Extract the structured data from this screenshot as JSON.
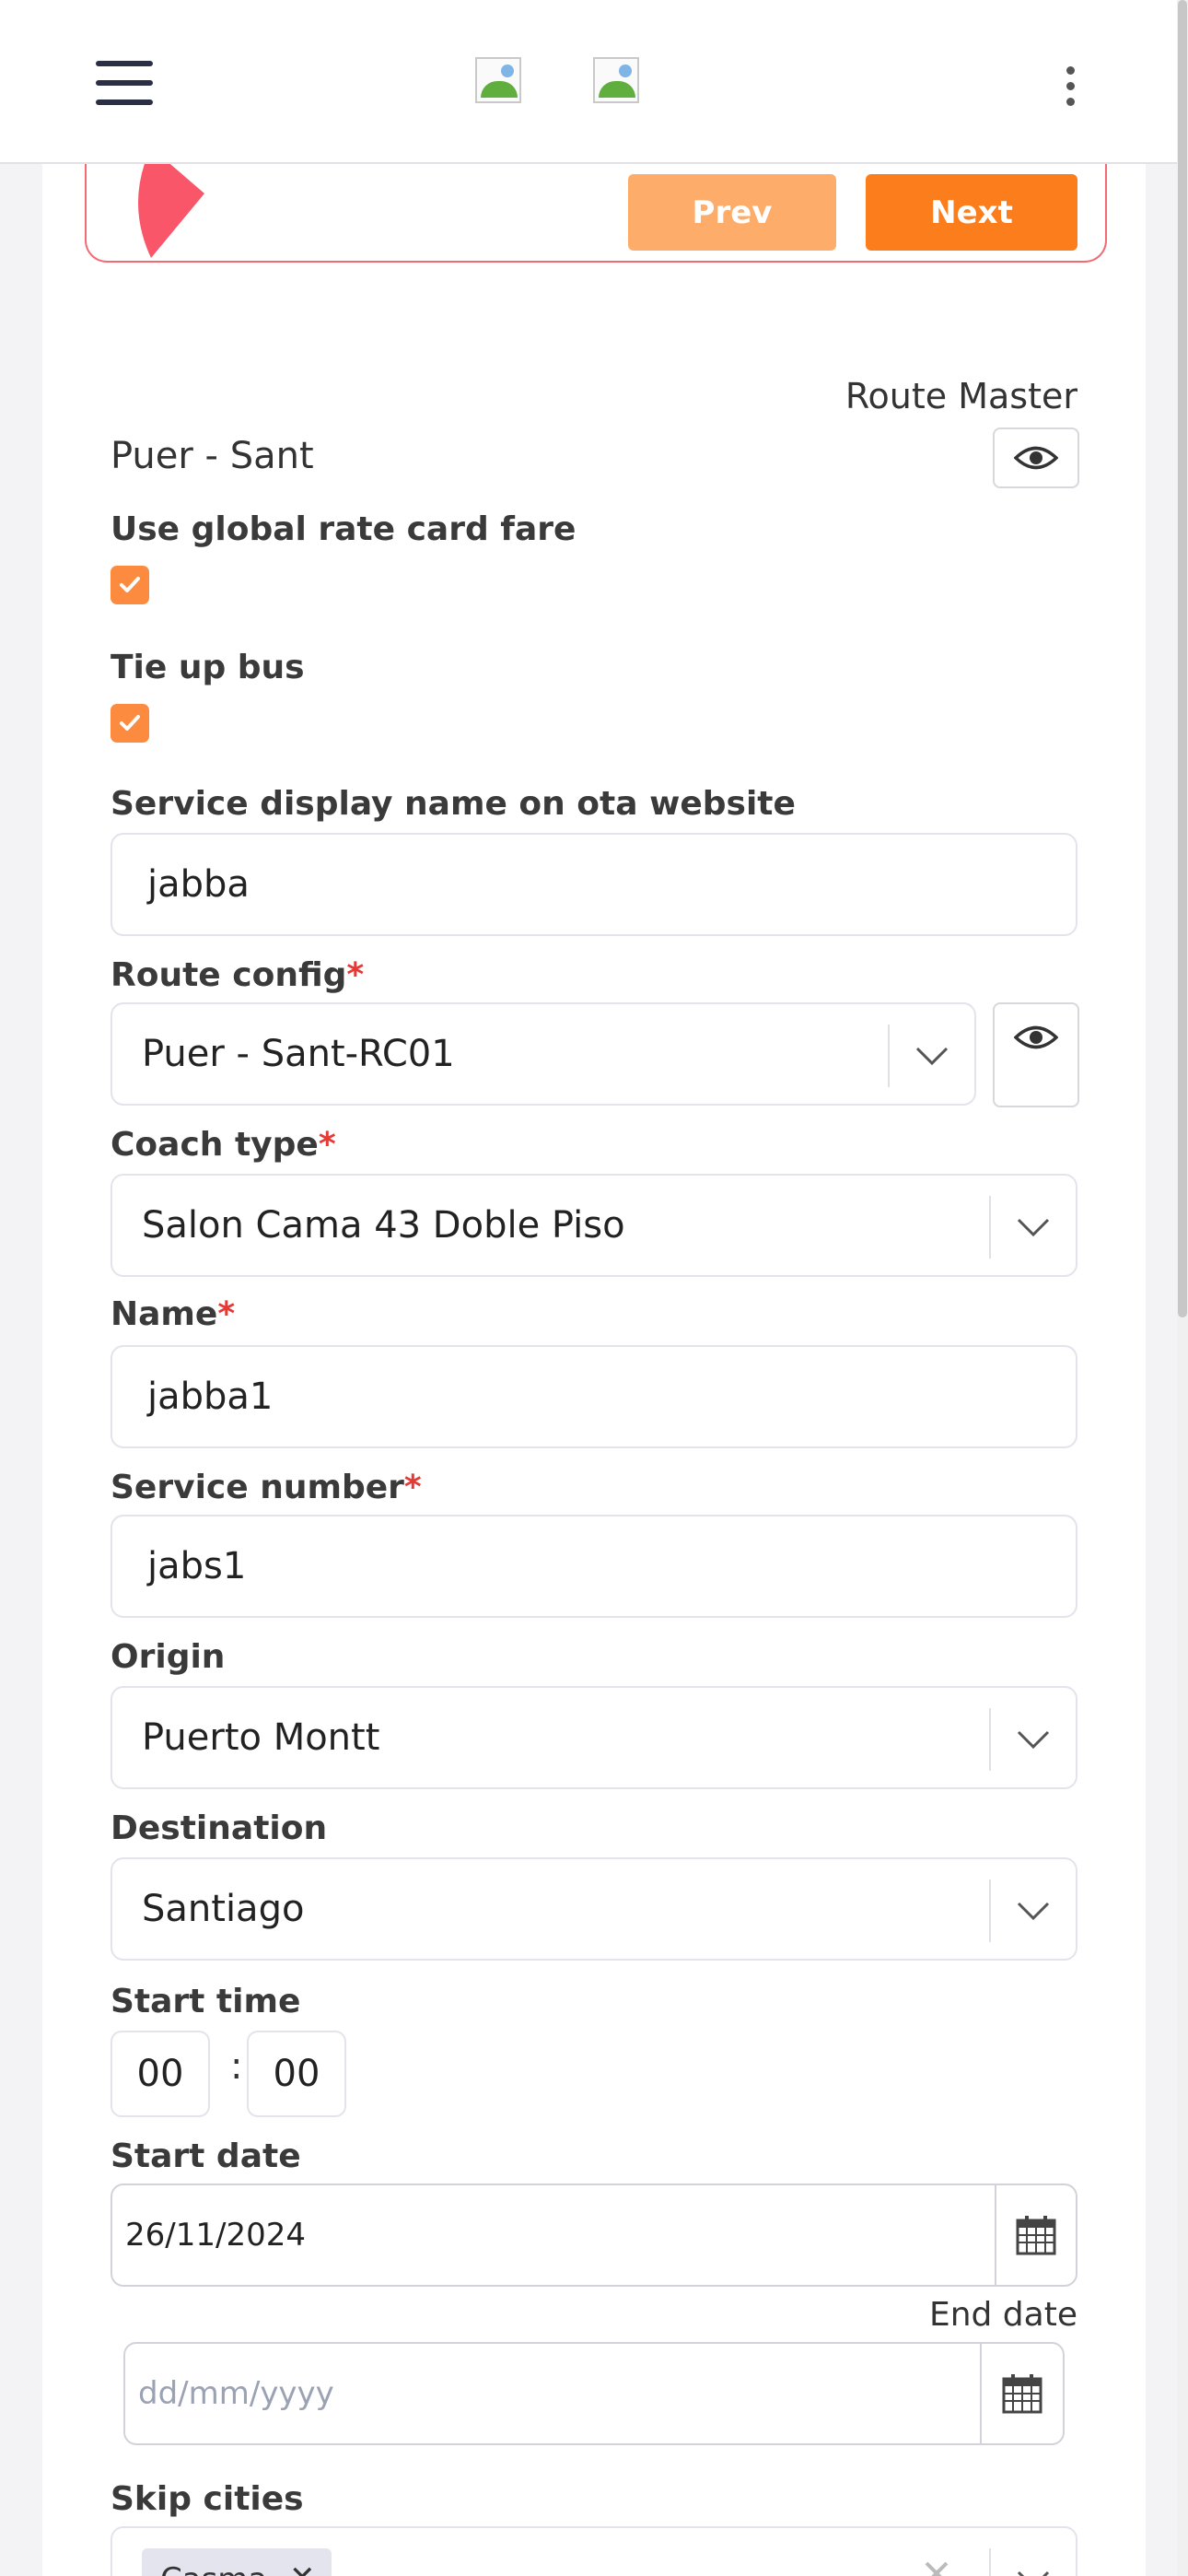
{
  "header": {
    "menu_icon": "hamburger-icon",
    "logo_icons": [
      "broken-image-icon",
      "broken-image-icon"
    ],
    "more_icon": "kebab-menu-icon"
  },
  "stepper": {
    "prev_label": "Prev",
    "next_label": "Next"
  },
  "colors": {
    "accent": "#fc7d1c",
    "accent_light": "#fdac6a",
    "checkbox": "#fc8b3f",
    "stepper_border": "#f26a74",
    "required": "#e53935"
  },
  "route_master": {
    "label": "Route Master",
    "value": "Puer - Sant"
  },
  "global_rate": {
    "label": "Use global rate card fare",
    "checked": true
  },
  "tie_up_bus": {
    "label": "Tie up bus",
    "checked": true
  },
  "service_display_name": {
    "label": "Service display name on ota website",
    "value": "jabba"
  },
  "route_config": {
    "label": "Route config",
    "required_mark": "*",
    "value": "Puer - Sant-RC01"
  },
  "coach_type": {
    "label": "Coach type",
    "required_mark": "*",
    "value": "Salon Cama 43 Doble Piso"
  },
  "name": {
    "label": "Name",
    "required_mark": "*",
    "value": "jabba1"
  },
  "service_number": {
    "label": "Service number",
    "required_mark": "*",
    "value": "jabs1"
  },
  "origin": {
    "label": "Origin",
    "value": "Puerto Montt"
  },
  "destination": {
    "label": "Destination",
    "value": "Santiago"
  },
  "start_time": {
    "label": "Start time",
    "hours": "00",
    "separator": ":",
    "minutes": "00"
  },
  "start_date": {
    "label": "Start date",
    "value": "26/11/2024"
  },
  "end_date": {
    "label": "End date",
    "placeholder": "dd/mm/yyyy"
  },
  "skip_cities": {
    "label": "Skip cities",
    "chips": [
      "Casma"
    ]
  }
}
